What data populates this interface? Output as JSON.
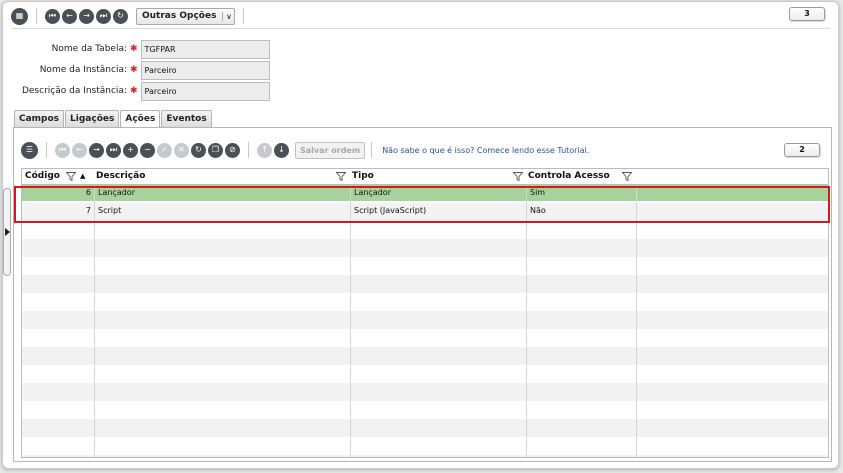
{
  "toolbar": {
    "other_options_label": "Outras Opções",
    "counter": "3"
  },
  "form": {
    "table_name_label": "Nome da Tabela:",
    "table_name_value": "TGFPAR",
    "instance_name_label": "Nome da Instância:",
    "instance_name_value": "Parceiro",
    "instance_desc_label": "Descrição da Instância:",
    "instance_desc_value": "Parceiro"
  },
  "tabs": [
    {
      "label": "Campos"
    },
    {
      "label": "Ligações"
    },
    {
      "label": "Ações"
    },
    {
      "label": "Eventos"
    }
  ],
  "panel_toolbar": {
    "save_order_label": "Salvar ordem",
    "tutorial_text": "Não sabe o que é isso? Comece lendo esse Tutorial.",
    "counter": "2"
  },
  "grid": {
    "columns": [
      {
        "label": "Código"
      },
      {
        "label": "Descrição"
      },
      {
        "label": "Tipo"
      },
      {
        "label": "Controla Acesso"
      }
    ],
    "sort_indicator": "▲",
    "rows": [
      {
        "code": "6",
        "description": "Lançador",
        "type": "Lançador",
        "access": "Sim"
      },
      {
        "code": "7",
        "description": "Script",
        "type": "Script (JavaScript)",
        "access": "Não"
      }
    ]
  },
  "colors": {
    "selected_row": "#a6d39b",
    "highlight_border": "#d11a1a",
    "link": "#2d4ea3"
  }
}
